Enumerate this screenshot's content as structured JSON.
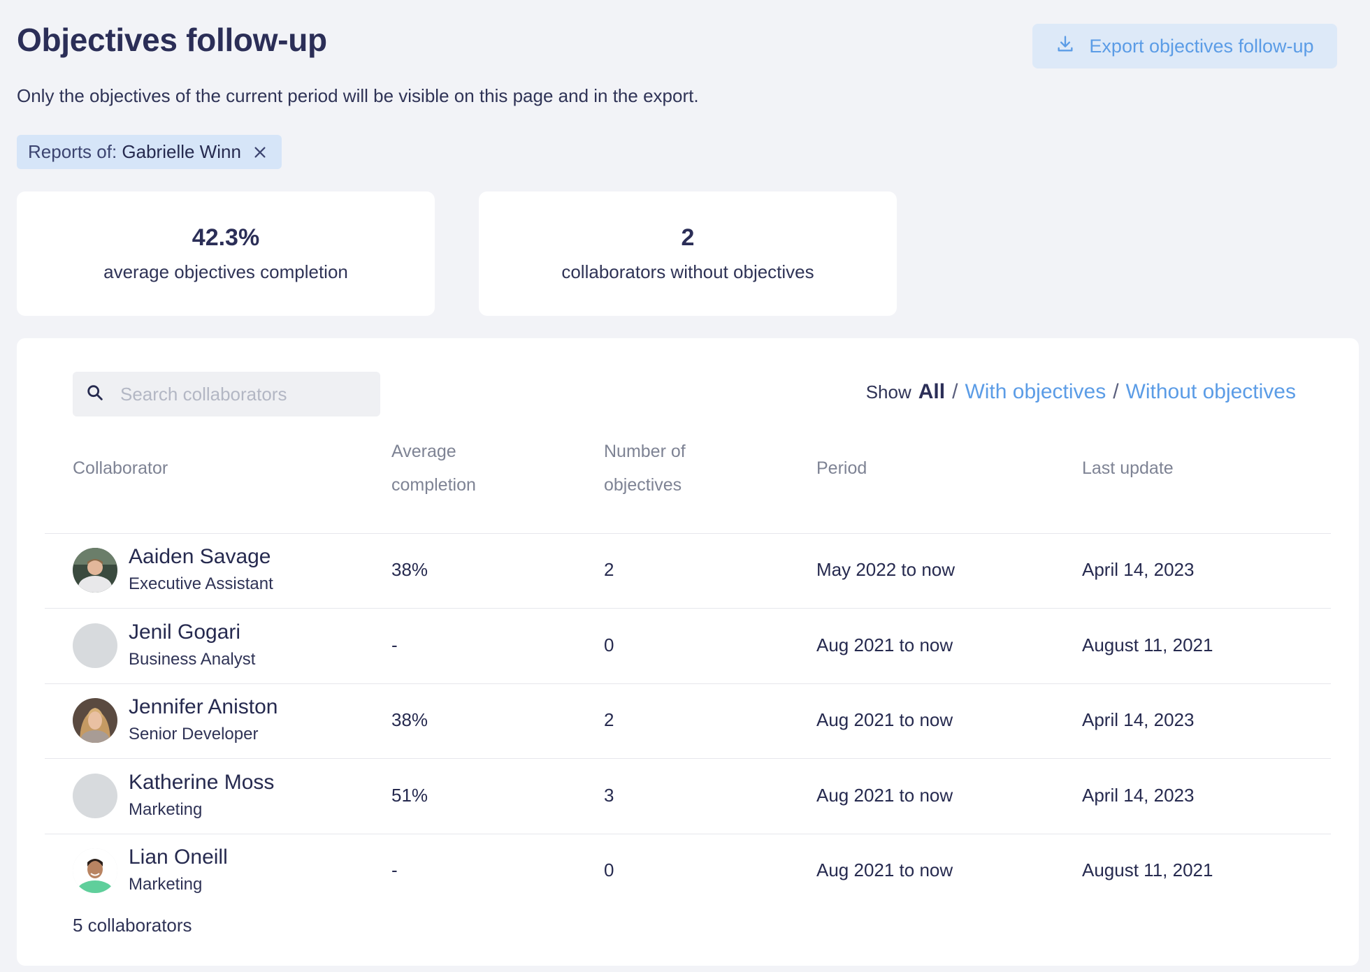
{
  "page": {
    "title": "Objectives follow-up",
    "subtitle": "Only the objectives of the current period will be visible on this page and in the export.",
    "export_label": "Export objectives follow-up"
  },
  "filter": {
    "label": "Reports of:",
    "value": "Gabrielle Winn"
  },
  "stats": [
    {
      "value": "42.3%",
      "label": "average objectives completion"
    },
    {
      "value": "2",
      "label": "collaborators without objectives"
    }
  ],
  "search": {
    "placeholder": "Search collaborators",
    "value": ""
  },
  "show_filter": {
    "prefix": "Show",
    "active": "All",
    "options": [
      "With objectives",
      "Without objectives"
    ],
    "separator": "/"
  },
  "table": {
    "headers": {
      "collaborator": "Collaborator",
      "avg_line1": "Average",
      "avg_line2": "completion",
      "num_line1": "Number of",
      "num_line2": "objectives",
      "period": "Period",
      "last_update": "Last update"
    },
    "rows": [
      {
        "name": "Aaiden Savage",
        "role": "Executive Assistant",
        "completion": "38%",
        "objectives": "2",
        "period": "May 2022 to now",
        "last_update": "April 14, 2023",
        "avatar": "photo"
      },
      {
        "name": "Jenil Gogari",
        "role": "Business Analyst",
        "completion": "-",
        "objectives": "0",
        "period": "Aug 2021 to now",
        "last_update": "August 11, 2021",
        "avatar": "placeholder"
      },
      {
        "name": "Jennifer Aniston",
        "role": "Senior Developer",
        "completion": "38%",
        "objectives": "2",
        "period": "Aug 2021 to now",
        "last_update": "April 14, 2023",
        "avatar": "photo"
      },
      {
        "name": "Katherine Moss",
        "role": "Marketing",
        "completion": "51%",
        "objectives": "3",
        "period": "Aug 2021 to now",
        "last_update": "April 14, 2023",
        "avatar": "placeholder"
      },
      {
        "name": "Lian Oneill",
        "role": "Marketing",
        "completion": "-",
        "objectives": "0",
        "period": "Aug 2021 to now",
        "last_update": "August 11, 2021",
        "avatar": "photo"
      }
    ],
    "footer": "5 collaborators"
  },
  "colors": {
    "accent": "#5b9ce6",
    "background": "#f2f3f7",
    "text": "#262a4f"
  },
  "icons": {
    "export": "download-icon",
    "filter_remove": "close-icon",
    "search": "search-icon"
  }
}
